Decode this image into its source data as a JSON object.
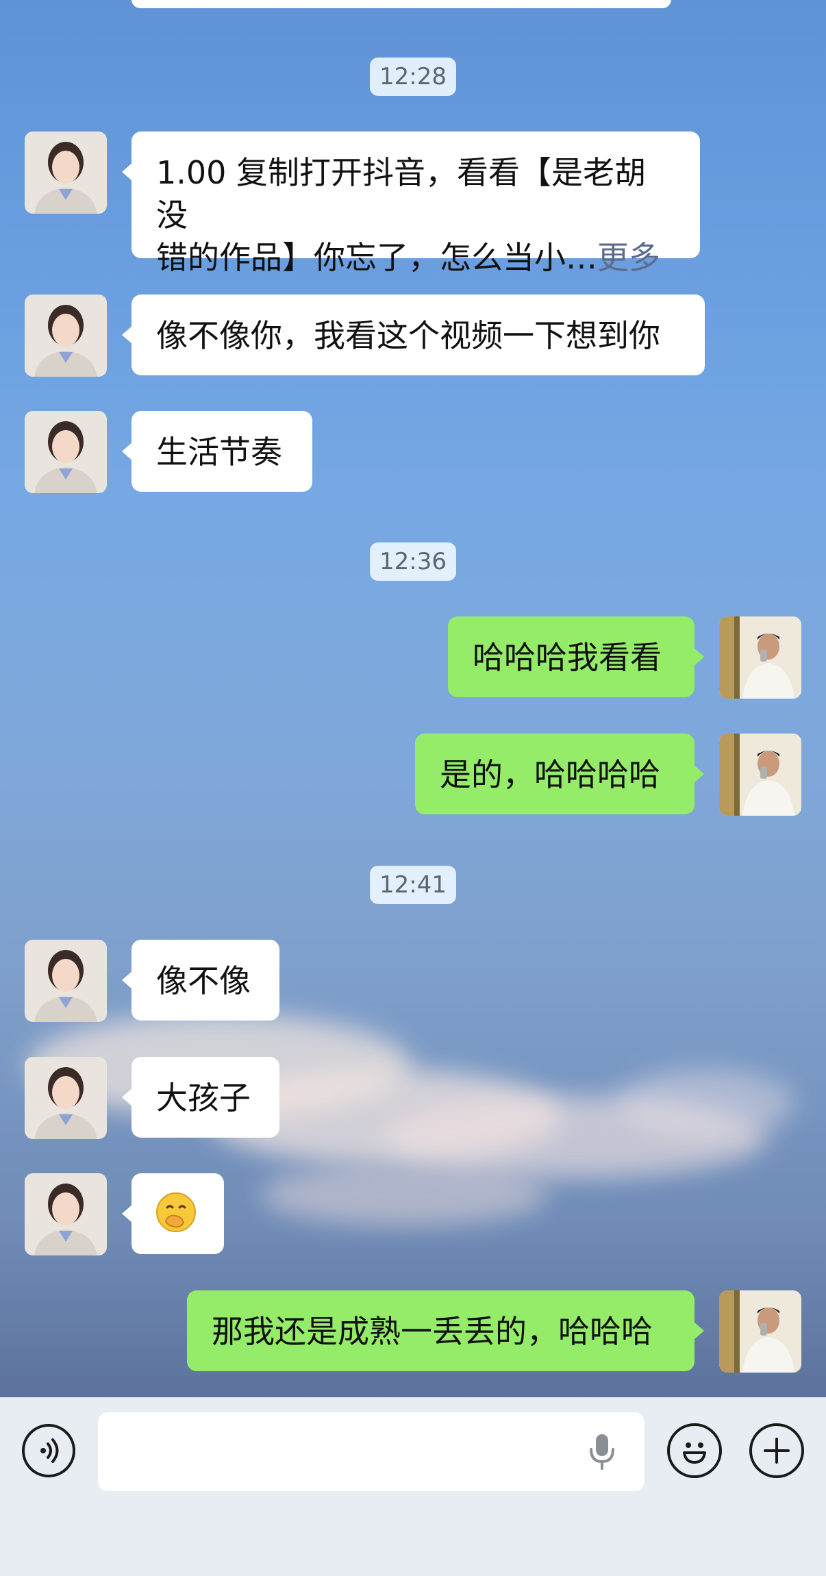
{
  "timestamps": [
    "12:28",
    "12:36",
    "12:41"
  ],
  "messages": [
    {
      "dir": "in",
      "text": "1.00 复制打开抖音，看看【是老胡没",
      "text2": "错的作品】你忘了，怎么当小…",
      "more": "更多"
    },
    {
      "dir": "in",
      "text": "像不像你，我看这个视频一下想到你"
    },
    {
      "dir": "in",
      "text": "生活节奏"
    },
    {
      "dir": "out",
      "text": "哈哈哈我看看"
    },
    {
      "dir": "out",
      "text": "是的，哈哈哈哈"
    },
    {
      "dir": "in",
      "text": "像不像"
    },
    {
      "dir": "in",
      "text": "大孩子"
    },
    {
      "dir": "in",
      "emoji": "🤭"
    },
    {
      "dir": "out",
      "text": "那我还是成熟一丢丢的，哈哈哈"
    }
  ],
  "input_bar": {
    "voice_icon": "voice-mode-icon",
    "mic_icon": "microphone-icon",
    "emoji_icon": "emoji-icon",
    "plus_icon": "plus-icon",
    "input_value": ""
  },
  "colors": {
    "incoming": "#ffffff",
    "outgoing": "#95ec69",
    "bar": "#e8ecf3"
  }
}
